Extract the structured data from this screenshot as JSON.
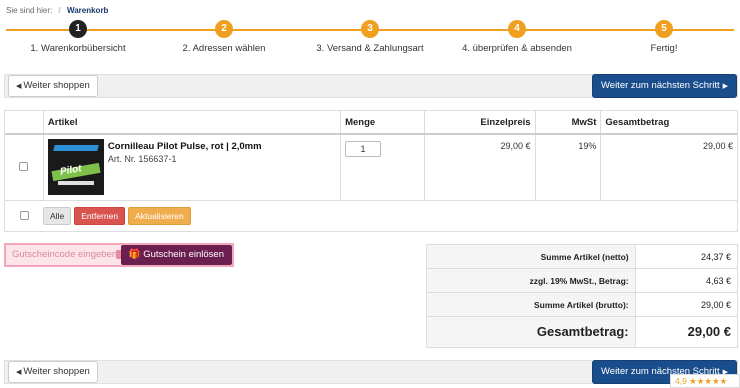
{
  "breadcrumb": {
    "prefix": "Sie sind hier:",
    "separator": "/",
    "current": "Warenkorb"
  },
  "steps": [
    {
      "number": "1",
      "label": "1. Warenkorbübersicht",
      "active": true
    },
    {
      "number": "2",
      "label": "2. Adressen wählen",
      "active": false
    },
    {
      "number": "3",
      "label": "3. Versand & Zahlungsart",
      "active": false
    },
    {
      "number": "4",
      "label": "4. überprüfen & absenden",
      "active": false
    },
    {
      "number": "5",
      "label": "Fertig!",
      "active": false
    }
  ],
  "toolbar": {
    "continue_label": "Weiter shoppen",
    "next_label": "Weiter zum nächsten Schritt"
  },
  "table": {
    "headers": {
      "article": "Artikel",
      "quantity": "Menge",
      "unit_price": "Einzelpreis",
      "vat": "MwSt",
      "total": "Gesamtbetrag"
    },
    "items": [
      {
        "name": "Cornilleau Pilot Pulse, rot | 2,0mm",
        "article_no": "Art. Nr. 156637-1",
        "quantity": "1",
        "unit_price": "29,00 €",
        "vat": "19%",
        "total": "29,00 €",
        "image_text": "Pilot"
      }
    ],
    "actions": {
      "all": "Alle",
      "remove": "Entfernen",
      "update": "Aktualisieren"
    }
  },
  "coupon": {
    "placeholder": "Gutscheincode eingeben",
    "button": "Gutschein einlösen"
  },
  "summary": {
    "net_label": "Summe Artikel (netto)",
    "net_value": "24,37 €",
    "vat_label": "zzgl. 19% MwSt., Betrag:",
    "vat_value": "4,63 €",
    "gross_label": "Summe Artikel (brutto):",
    "gross_value": "29,00 €",
    "total_label": "Gesamtbetrag:",
    "total_value": "29,00 €"
  },
  "rating": {
    "text": "4,9 ★★★★★"
  },
  "colors": {
    "accent": "#f0a020",
    "primary_button": "#1a4d8c",
    "coupon_button": "#6b1f4f",
    "remove_button": "#d9534f",
    "update_button": "#f0ad4e"
  }
}
